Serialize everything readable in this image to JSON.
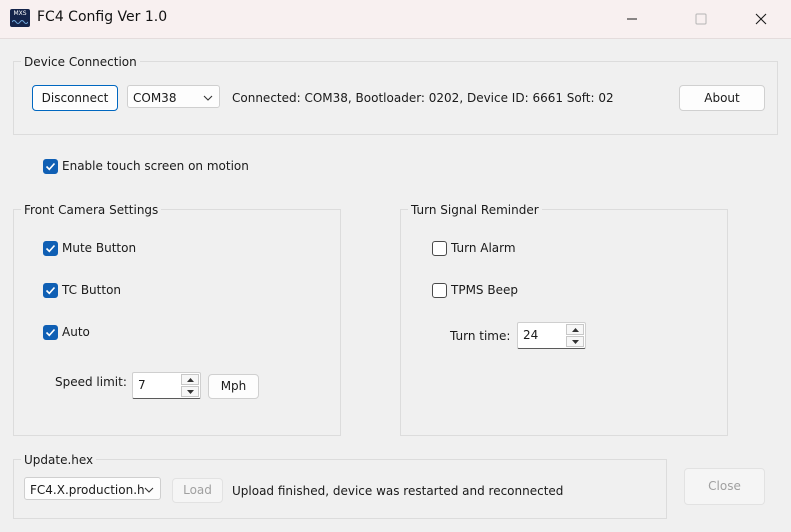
{
  "window": {
    "title": "FC4 Config Ver 1.0",
    "icon_text": "MXS",
    "icon": "app-logo-icon"
  },
  "device_connection": {
    "legend": "Device Connection",
    "disconnect_label": "Disconnect",
    "port_selected": "COM38",
    "status": "Connected: COM38, Bootloader: 0202, Device ID: 6661 Soft: 02",
    "about_label": "About"
  },
  "touch": {
    "label": "Enable touch screen on motion",
    "checked": true
  },
  "front_camera": {
    "legend": "Front Camera Settings",
    "mute_button": {
      "label": "Mute Button",
      "checked": true
    },
    "tc_button": {
      "label": "TC Button",
      "checked": true
    },
    "auto": {
      "label": "Auto",
      "checked": true
    },
    "speed_limit_label": "Speed limit:",
    "speed_limit_value": "7",
    "unit_button": "Mph"
  },
  "turn_signal": {
    "legend": "Turn Signal Reminder",
    "turn_alarm": {
      "label": "Turn Alarm",
      "checked": false
    },
    "tpms_beep": {
      "label": "TPMS Beep",
      "checked": false
    },
    "turn_time_label": "Turn time:",
    "turn_time_value": "24"
  },
  "update": {
    "legend": "Update.hex",
    "file_selected": "FC4.X.production.h",
    "load_label": "Load",
    "status": "Upload finished, device was restarted and reconnected"
  },
  "close_label": "Close",
  "colors": {
    "accent": "#0f5fb4",
    "primary_border": "#0067c0",
    "titlebar": "#f8f0f0"
  }
}
